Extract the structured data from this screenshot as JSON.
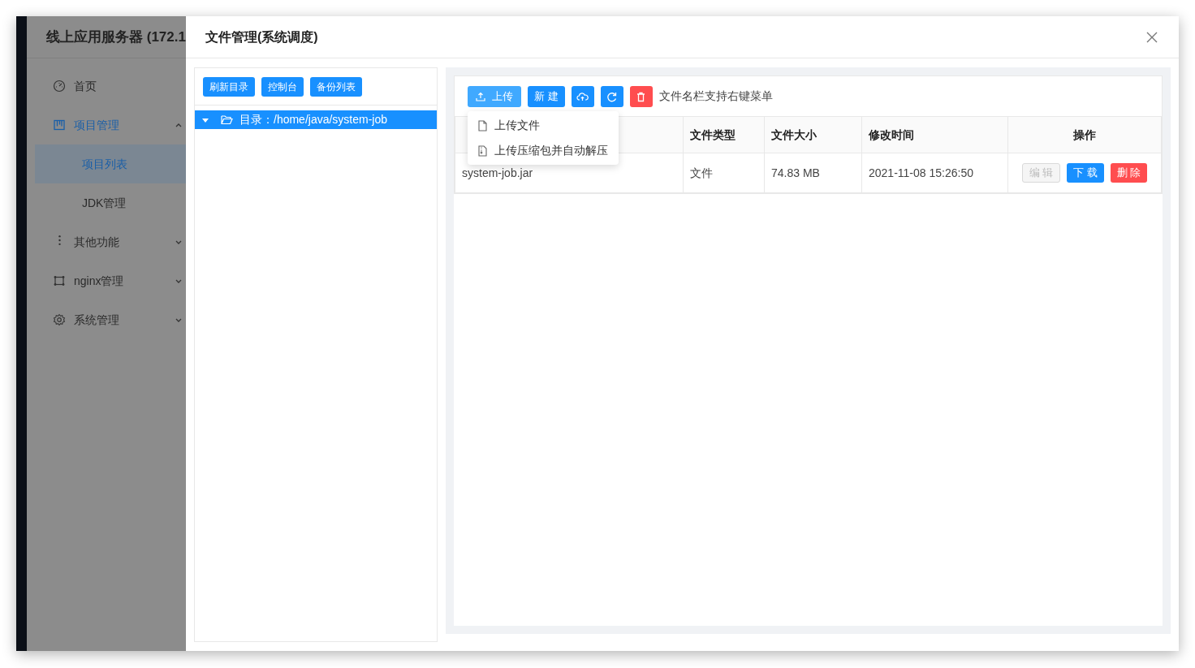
{
  "app_title": "线上应用服务器 (172.1",
  "sidebar": {
    "items": [
      {
        "label": "首页"
      },
      {
        "label": "项目管理",
        "expanded": true,
        "children": [
          {
            "label": "项目列表",
            "selected": true
          },
          {
            "label": "JDK管理",
            "selected": false
          }
        ]
      },
      {
        "label": "其他功能",
        "expanded": false
      },
      {
        "label": "nginx管理",
        "expanded": false
      },
      {
        "label": "系统管理",
        "expanded": false
      }
    ]
  },
  "dialog": {
    "title": "文件管理(系统调度)",
    "left_buttons": [
      "刷新目录",
      "控制台",
      "备份列表"
    ],
    "tree": [
      {
        "label": "目录：/home/java/system-job",
        "selected": true,
        "expanded": true
      }
    ],
    "toolbar": [
      {
        "kind": "upload",
        "label": "上传"
      },
      {
        "kind": "text",
        "label": "新 建"
      },
      {
        "kind": "cloud"
      },
      {
        "kind": "refresh"
      },
      {
        "kind": "trash"
      }
    ],
    "hint": "文件名栏支持右键菜单",
    "upload_menu": [
      "上传文件",
      "上传压缩包并自动解压"
    ],
    "table": {
      "columns": [
        "",
        "文件类型",
        "文件大小",
        "修改时间",
        "操作"
      ],
      "rows": [
        {
          "cells": [
            "system-job.jar",
            "文件",
            "74.83 MB",
            "2021-11-08 15:26:50"
          ],
          "actions": [
            {
              "label": "编 辑",
              "kind": "disabled"
            },
            {
              "label": "下 载",
              "kind": "primary"
            },
            {
              "label": "删 除",
              "kind": "danger"
            }
          ]
        }
      ]
    }
  }
}
